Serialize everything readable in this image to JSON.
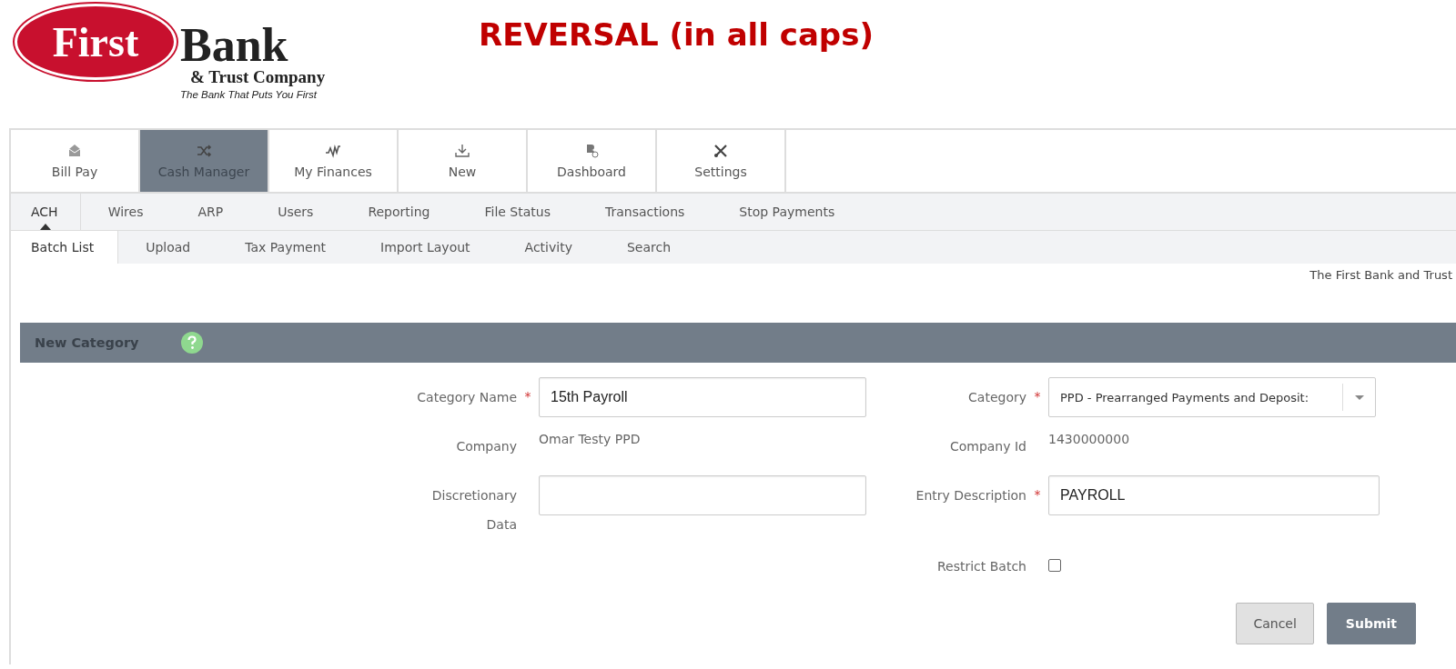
{
  "logo": {
    "word_1": "First",
    "word_2": "Bank",
    "subtitle": "& Trust Company",
    "tagline": "The Bank That Puts You First"
  },
  "slide_note": "REVERSAL (in all caps)",
  "main_nav": [
    {
      "label": "Bill Pay",
      "selected": false
    },
    {
      "label": "Cash Manager",
      "selected": true
    },
    {
      "label": "My Finances",
      "selected": false
    },
    {
      "label": "New",
      "selected": false
    },
    {
      "label": "Dashboard",
      "selected": false
    },
    {
      "label": "Settings",
      "selected": false
    }
  ],
  "sub_nav": [
    {
      "label": "ACH",
      "selected": true
    },
    {
      "label": "Wires",
      "selected": false
    },
    {
      "label": "ARP",
      "selected": false
    },
    {
      "label": "Users",
      "selected": false
    },
    {
      "label": "Reporting",
      "selected": false
    },
    {
      "label": "File Status",
      "selected": false
    },
    {
      "label": "Transactions",
      "selected": false
    },
    {
      "label": "Stop Payments",
      "selected": false
    }
  ],
  "tabs": [
    {
      "label": "Batch List",
      "selected": true
    },
    {
      "label": "Upload",
      "selected": false
    },
    {
      "label": "Tax Payment",
      "selected": false
    },
    {
      "label": "Import Layout",
      "selected": false
    },
    {
      "label": "Activity",
      "selected": false
    },
    {
      "label": "Search",
      "selected": false
    }
  ],
  "org_name": "The First Bank and Trust",
  "panel": {
    "title": "New Category",
    "fields": [
      {
        "kind": "input",
        "label": "Category Name",
        "required_mark": "*",
        "value": "15th Payroll"
      },
      {
        "kind": "select",
        "label": "Category",
        "required_mark": "*",
        "value": "PPD - Prearranged Payments and Deposit:"
      },
      {
        "kind": "text",
        "label": "Company",
        "value": "Omar Testy PPD"
      },
      {
        "kind": "text",
        "label": "Company Id",
        "value": "1430000000"
      },
      {
        "kind": "input",
        "label": "Discretionary Data"
      },
      {
        "kind": "input",
        "label": "Entry Description",
        "required_mark": "*",
        "value": "PAYROLL"
      },
      {
        "kind": "blank"
      },
      {
        "kind": "checkbox",
        "label": "Restrict Batch",
        "checked": false
      }
    ],
    "buttons": [
      {
        "label": "Cancel",
        "kind": "secondary"
      },
      {
        "label": "Submit",
        "kind": "primary"
      }
    ]
  }
}
